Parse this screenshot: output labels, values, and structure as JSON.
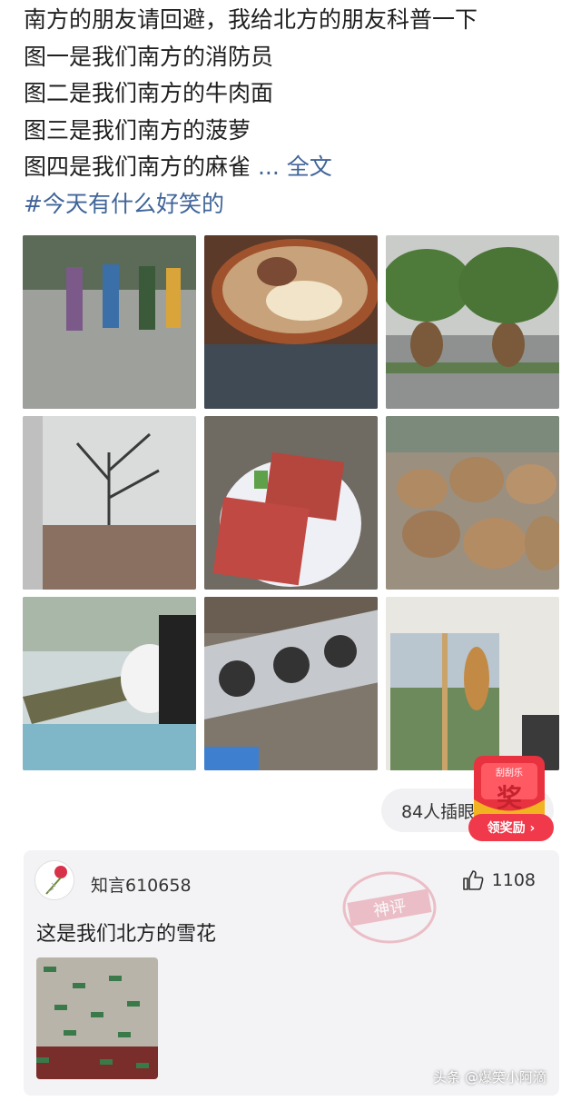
{
  "post": {
    "lines": [
      "南方的朋友请回避，我给北方的朋友科普一下",
      "图一是我们南方的消防员",
      "图二是我们南方的牛肉面",
      "图三是我们南方的菠萝",
      "图四是我们南方的麻雀"
    ],
    "ellipsis": " ...",
    "more_label": "全文",
    "hashtag": "#今天有什么好笑的"
  },
  "images": [
    {
      "subject": "costumed-figures-plaza"
    },
    {
      "subject": "beef-noodle-bowl"
    },
    {
      "subject": "palm-trees"
    },
    {
      "subject": "bare-tree-rooftop"
    },
    {
      "subject": "red-blocks-plate"
    },
    {
      "subject": "rock-pile"
    },
    {
      "subject": "crocodile-in-lace"
    },
    {
      "subject": "rooftop-fan-units"
    },
    {
      "subject": "cat-on-glass-door"
    }
  ],
  "read_count": "84人插眼",
  "reward": {
    "badge_top": "刮刮乐",
    "badge_char": "奖",
    "button_label": "领奖励 ›"
  },
  "comment": {
    "username": "知言610658",
    "likes": "1108",
    "text": "这是我们北方的雪花",
    "stamp_text": "神评"
  },
  "watermark": "头条 @爆笑小阿滴",
  "colors": {
    "link": "#406599",
    "reward_red": "#f0394a",
    "comment_bg": "#f3f3f5"
  }
}
